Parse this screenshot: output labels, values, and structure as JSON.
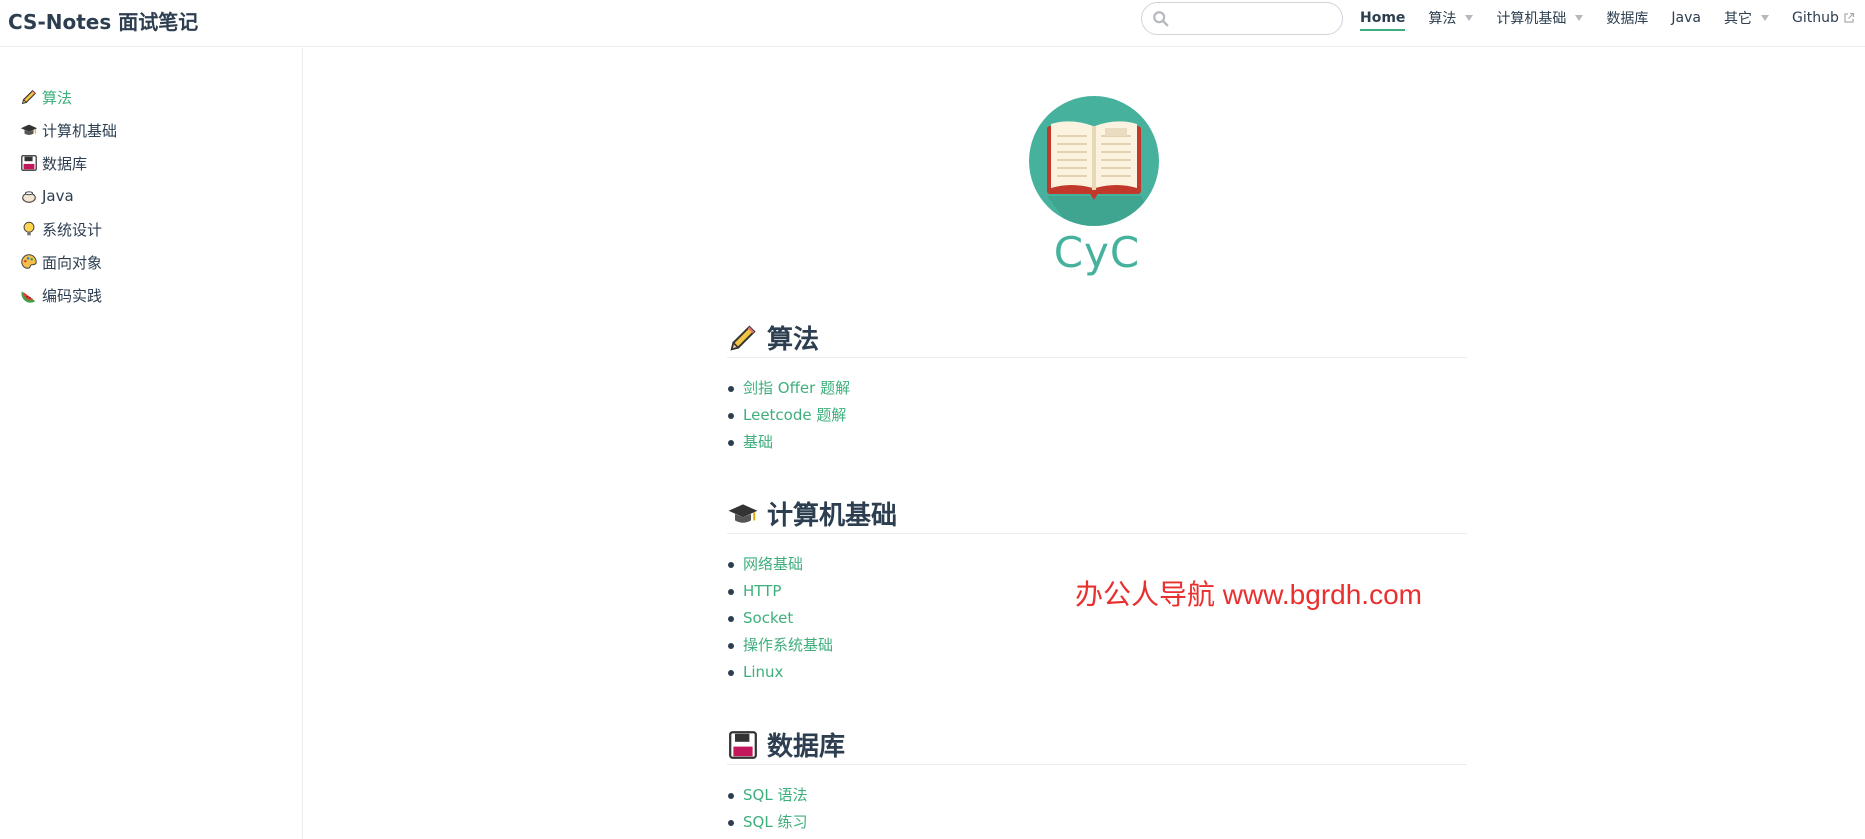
{
  "navbar": {
    "site_title": "CS-Notes 面试笔记",
    "search": {
      "placeholder": "",
      "value": ""
    },
    "items": [
      {
        "label": "Home",
        "active": true,
        "dropdown": false
      },
      {
        "label": "算法",
        "active": false,
        "dropdown": true
      },
      {
        "label": "计算机基础",
        "active": false,
        "dropdown": true
      },
      {
        "label": "数据库",
        "active": false,
        "dropdown": false
      },
      {
        "label": "Java",
        "active": false,
        "dropdown": false
      },
      {
        "label": "其它",
        "active": false,
        "dropdown": true
      },
      {
        "label": "Github",
        "active": false,
        "dropdown": false,
        "external": true
      }
    ]
  },
  "sidebar": {
    "items": [
      {
        "icon": "pencil-icon",
        "label": "算法",
        "active": true
      },
      {
        "icon": "graduation-cap-icon",
        "label": "计算机基础",
        "active": false
      },
      {
        "icon": "floppy-disk-icon",
        "label": "数据库",
        "active": false
      },
      {
        "icon": "teapot-icon",
        "label": "Java",
        "active": false
      },
      {
        "icon": "lightbulb-icon",
        "label": "系统设计",
        "active": false
      },
      {
        "icon": "palette-icon",
        "label": "面向对象",
        "active": false
      },
      {
        "icon": "watermelon-icon",
        "label": "编码实践",
        "active": false
      }
    ]
  },
  "hero": {
    "logo_icon": "open-book-icon",
    "name": "CyC"
  },
  "sections": [
    {
      "icon": "pencil-icon",
      "title": "算法",
      "links": [
        "剑指 Offer 题解",
        "Leetcode 题解",
        "基础"
      ]
    },
    {
      "icon": "graduation-cap-icon",
      "title": "计算机基础",
      "links": [
        "网络基础",
        "HTTP",
        "Socket",
        "操作系统基础",
        "Linux"
      ]
    },
    {
      "icon": "floppy-disk-icon",
      "title": "数据库",
      "links": [
        "SQL 语法",
        "SQL 练习"
      ]
    }
  ],
  "watermark": "办公人导航 www.bgrdh.com",
  "colors": {
    "accent": "#3eaf7c",
    "logo_bg": "#46b29d",
    "text": "#2c3e50",
    "watermark": "#e8302f"
  }
}
